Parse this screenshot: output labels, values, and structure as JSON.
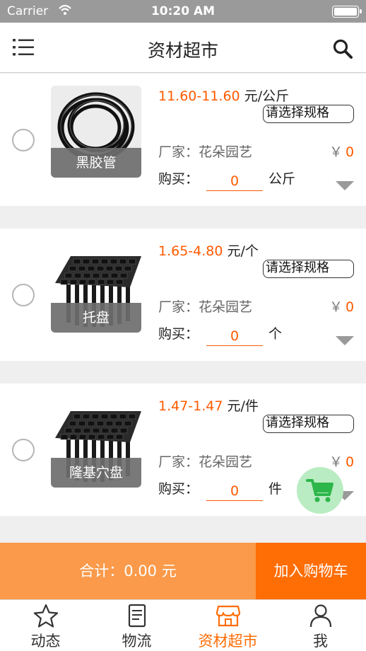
{
  "status_bar": {
    "carrier": "Carrier",
    "time": "10:20 AM"
  },
  "nav": {
    "title": "资材超市",
    "menu_icon": "list-icon",
    "search_icon": "search-icon"
  },
  "products": [
    {
      "name": "黑胶管",
      "price_range": "11.60-11.60",
      "price_unit": "元/公斤",
      "spec_button": "请选择规格",
      "maker_label": "厂家：花朵园艺",
      "currency": "￥",
      "subtotal": "0",
      "buy_label": "购买：",
      "quantity": "0",
      "unit": "公斤"
    },
    {
      "name": "托盘",
      "price_range": "1.65-4.80",
      "price_unit": "元/个",
      "spec_button": "请选择规格",
      "maker_label": "厂家：花朵园艺",
      "currency": "￥",
      "subtotal": "0",
      "buy_label": "购买：",
      "quantity": "0",
      "unit": "个"
    },
    {
      "name": "隆基穴盘",
      "price_range": "1.47-1.47",
      "price_unit": "元/件",
      "spec_button": "请选择规格",
      "maker_label": "厂家：花朵园艺",
      "currency": "￥",
      "subtotal": "0",
      "buy_label": "购买：",
      "quantity": "0",
      "unit": "件"
    }
  ],
  "summary": {
    "total_label": "合计：0.00 元",
    "add_to_cart": "加入购物车"
  },
  "tabs": [
    {
      "label": "动态",
      "icon": "star-icon",
      "active": false
    },
    {
      "label": "物流",
      "icon": "document-icon",
      "active": false
    },
    {
      "label": "资材超市",
      "icon": "shop-icon",
      "active": true
    },
    {
      "label": "我",
      "icon": "person-icon",
      "active": false
    }
  ],
  "colors": {
    "accent": "#ff6d05",
    "price": "#ff5a00",
    "summary_bg": "#fa9a4a",
    "cart_fab": "#b9ecc2",
    "cart_icon": "#2db64a"
  }
}
